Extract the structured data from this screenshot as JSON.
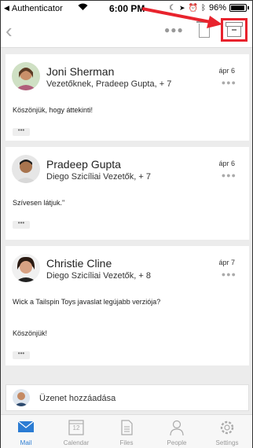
{
  "status_bar": {
    "carrier": "Authenticator",
    "time": "6:00 PM",
    "battery": "96%"
  },
  "messages": [
    {
      "sender": "Joni Sherman",
      "recipients": "Vezetőknek, Pradeep Gupta, + 7",
      "date": "ápr 6",
      "body_lines": [
        "Köszönjük, hogy áttekinti!"
      ]
    },
    {
      "sender": "Pradeep Gupta",
      "recipients": "Diego Szicíliai Vezetők, + 7",
      "date": "ápr 6",
      "body_lines": [
        "Szívesen látjuk.\""
      ]
    },
    {
      "sender": "Christie Cline",
      "recipients": "Diego Szicíliai Vezetők, + 8",
      "date": "ápr 7",
      "body_lines": [
        "Wick a Tailspin Toys javaslat legújabb verziója?",
        "Köszönjük!"
      ]
    }
  ],
  "reply": {
    "placeholder": "Üzenet hozzáadása"
  },
  "tabs": [
    {
      "label": "Mail",
      "icon": "mail-icon",
      "active": true
    },
    {
      "label": "Calendar",
      "icon": "calendar-icon",
      "badge": "12"
    },
    {
      "label": "Files",
      "icon": "files-icon"
    },
    {
      "label": "People",
      "icon": "people-icon"
    },
    {
      "label": "Settings",
      "icon": "settings-icon"
    }
  ],
  "colors": {
    "accent": "#2b7cd3",
    "annotation": "#e8232d"
  }
}
